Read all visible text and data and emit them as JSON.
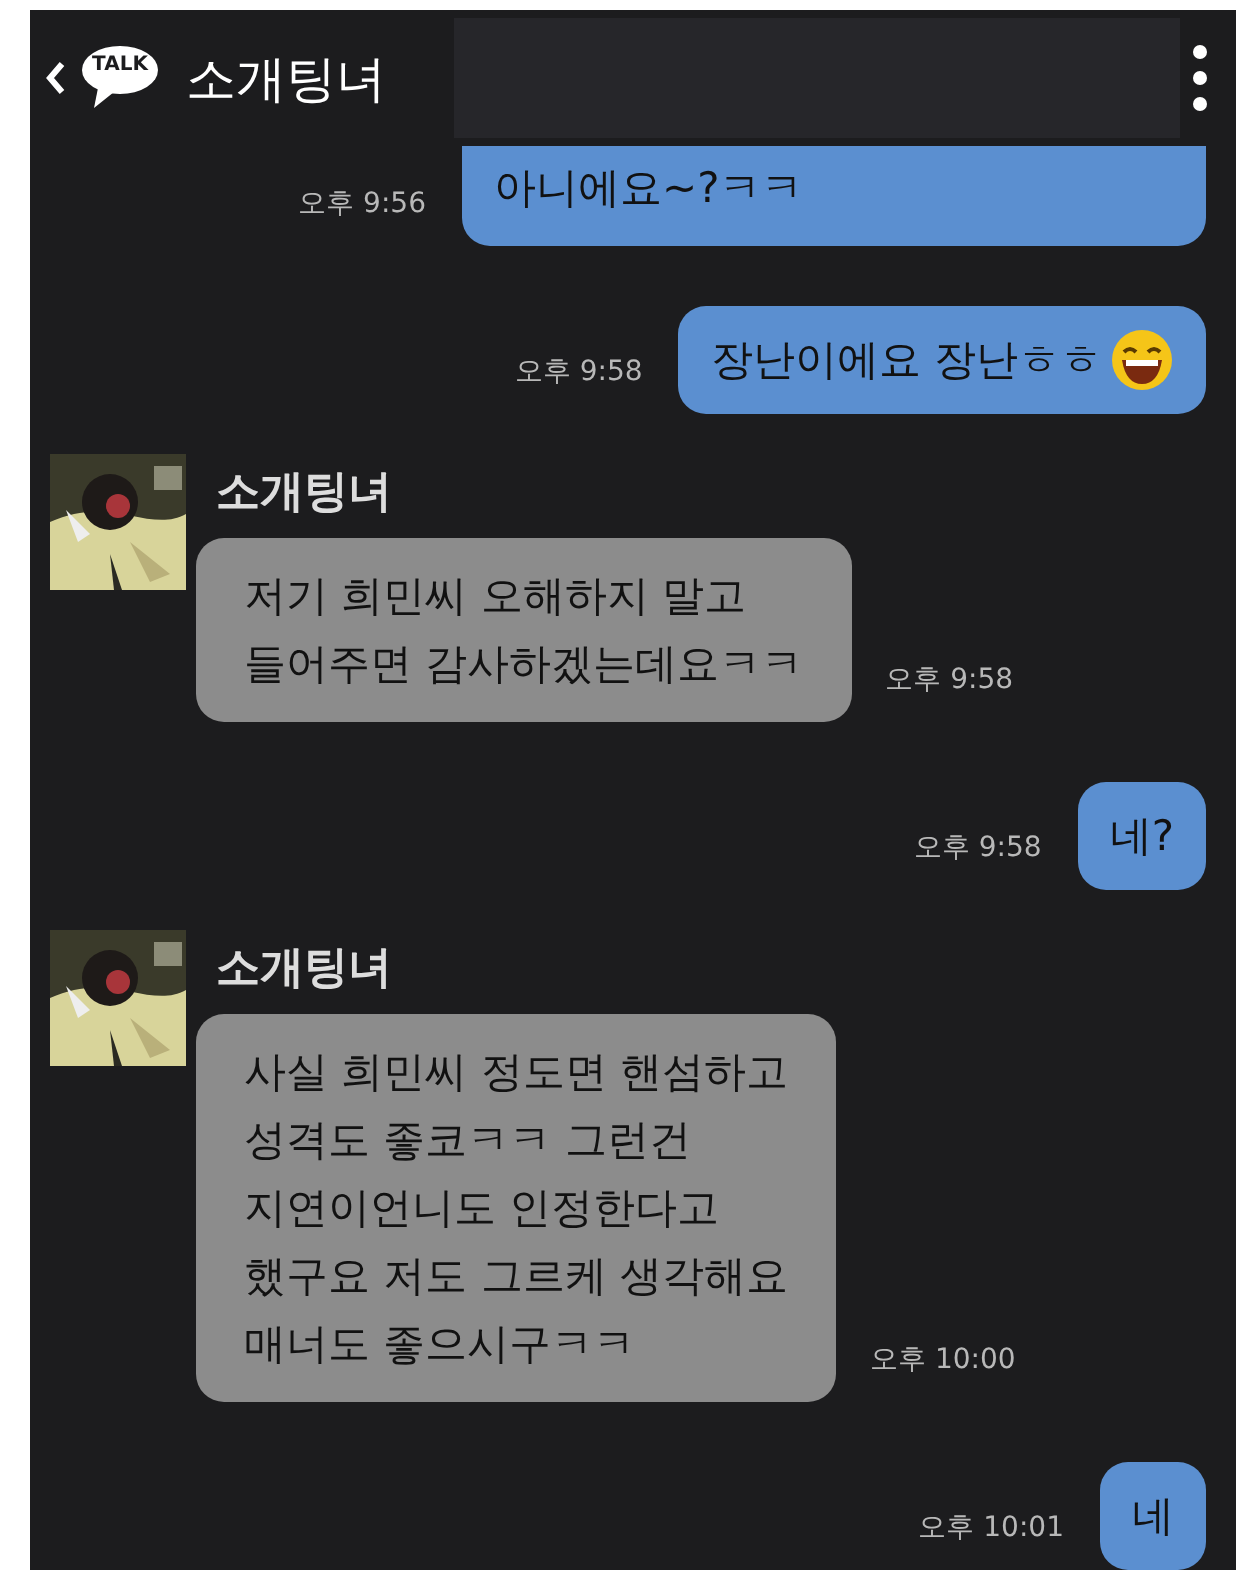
{
  "header": {
    "title": "소개팅녀",
    "logo_text": "TALK"
  },
  "messages": [
    {
      "kind": "sent",
      "lines": [
        "아니에요~?ㅋㅋ"
      ],
      "time": "오후 9:56",
      "cut_top": true,
      "emoji": false
    },
    {
      "kind": "sent",
      "lines": [
        "장난이에요 장난ㅎㅎ"
      ],
      "time": "오후 9:58",
      "cut_top": false,
      "emoji": true
    },
    {
      "kind": "received",
      "sender": "소개팅녀",
      "lines": [
        "저기 희민씨 오해하지 말고",
        "들어주면 감사하겠는데요ㅋㅋ"
      ],
      "time": "오후 9:58"
    },
    {
      "kind": "sent",
      "lines": [
        "네?"
      ],
      "time": "오후 9:58",
      "cut_top": false,
      "emoji": false
    },
    {
      "kind": "received",
      "sender": "소개팅녀",
      "lines": [
        "사실 희민씨 정도면 핸섬하고",
        "성격도 좋코ㅋㅋ 그런건",
        "지연이언니도 인정한다고",
        "했구요 저도 그르케 생각해요",
        "매너도 좋으시구ㅋㅋ"
      ],
      "time": "오후 10:00"
    },
    {
      "kind": "sent",
      "lines": [
        "네"
      ],
      "time": "오후 10:01",
      "cut_top": false,
      "emoji": false
    }
  ]
}
